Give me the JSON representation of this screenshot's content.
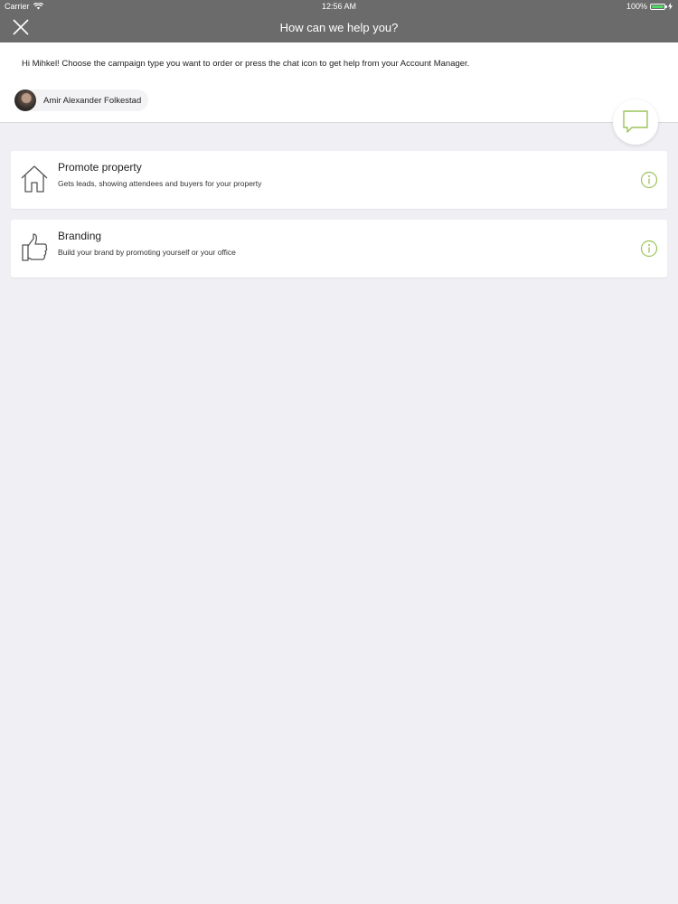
{
  "status_bar": {
    "carrier": "Carrier",
    "time": "12:56 AM",
    "battery": "100%",
    "battery_level": 1.0,
    "icons": [
      "wifi-icon",
      "battery-icon",
      "charging-icon"
    ]
  },
  "nav": {
    "title": "How can we help you?",
    "close_icon": "close-icon"
  },
  "header": {
    "intro": "Hi Mihkel! Choose the campaign type you want to order or press the chat icon to get help from your Account Manager.",
    "manager_name": "Amir Alexander Folkestad",
    "chat_icon": "chat-bubble-icon"
  },
  "campaigns": [
    {
      "title": "Promote property",
      "description": "Gets leads, showing attendees and buyers for your property",
      "icon": "house-icon"
    },
    {
      "title": "Branding",
      "description": "Build your brand by promoting yourself or your office",
      "icon": "thumbs-up-icon"
    }
  ],
  "colors": {
    "header_bg": "#6b6b6b",
    "accent": "#9cc35a",
    "page_bg": "#efeff4",
    "battery": "#4cd964"
  }
}
